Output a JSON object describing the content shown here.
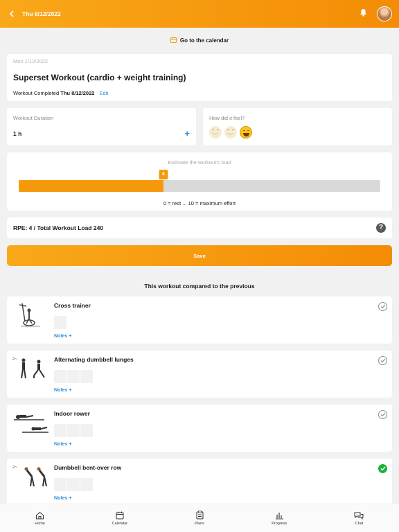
{
  "header": {
    "date": "Thu 8/12/2022"
  },
  "calendar_link": "Go to the calendar",
  "workout": {
    "planned_date": "Mon 1/12/2022",
    "title": "Superset Workout (cardio + weight training)",
    "status_label": "Workout Completed",
    "completed_date": "Thu 8/12/2022",
    "edit_label": "Edit"
  },
  "duration": {
    "label": "Workout Duration",
    "value": "1 h"
  },
  "feel": {
    "label": "How did it feel?",
    "selected": 3
  },
  "load": {
    "title": "Estimate the workout's load",
    "value": "4",
    "fraction": 0.4,
    "scale": "0 = rest ... 10 = maximum effort"
  },
  "rpe": {
    "text": "RPE: 4 / Total Workout Load 240"
  },
  "save_label": "Save",
  "compare_title": "This workout compared to the previous",
  "exercises": [
    {
      "name": "Cross trainer",
      "notes": "Notes +",
      "sets": 1,
      "done": false
    },
    {
      "name": "Alternating dumbbell lunges",
      "notes": "Notes +",
      "sets": 3,
      "done": false
    },
    {
      "name": "Indoor rower",
      "notes": "Notes +",
      "sets": 3,
      "done": false
    },
    {
      "name": "Dumbbell bent-over row",
      "notes": "Notes +",
      "sets": 3,
      "done": true
    }
  ],
  "nav": [
    {
      "label": "Home",
      "icon": "home-icon"
    },
    {
      "label": "Calendar",
      "icon": "calendar-icon"
    },
    {
      "label": "Plans",
      "icon": "clipboard-icon"
    },
    {
      "label": "Progress",
      "icon": "bar-chart-icon"
    },
    {
      "label": "Chat",
      "icon": "chat-icon"
    }
  ],
  "colors": {
    "accent": "#f59a0d",
    "link": "#2f8fdc",
    "success": "#1db33a"
  }
}
